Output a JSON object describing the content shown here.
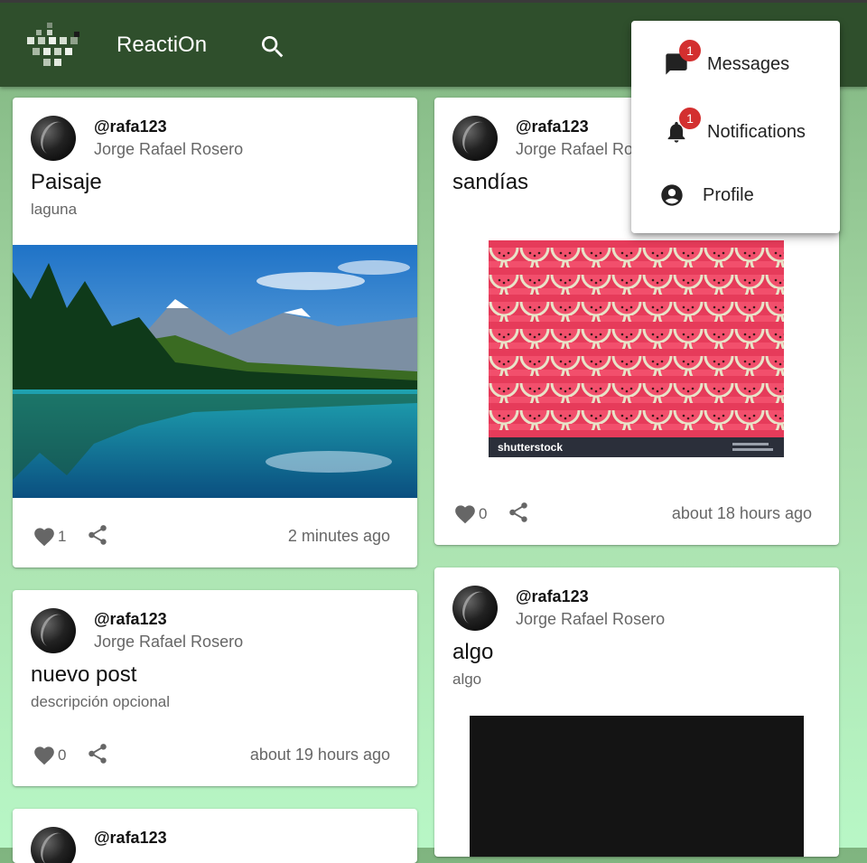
{
  "app": {
    "title": "ReactiOn"
  },
  "icons": {
    "logo": "pixel-logo-icon",
    "search": "search-icon",
    "like": "heart-icon",
    "share": "share-icon",
    "messages": "chat-icon",
    "notifications": "bell-icon",
    "profile": "account-circle-icon"
  },
  "colors": {
    "appbar": "#2f4f2c",
    "badge": "#d32f2f"
  },
  "menu": {
    "messages": {
      "label": "Messages",
      "badge": "1"
    },
    "notifications": {
      "label": "Notifications",
      "badge": "1"
    },
    "profile": {
      "label": "Profile"
    }
  },
  "posts": [
    {
      "username": "@rafa123",
      "fullname": "Jorge Rafael Rosero",
      "title": "Paisaje",
      "description": "laguna",
      "likes": "1",
      "time": "2 minutes ago"
    },
    {
      "username": "@rafa123",
      "fullname": "Jorge Rafael Rosero",
      "title": "sandías",
      "description": "",
      "likes": "0",
      "time": "about 18 hours ago",
      "image_watermark": "shutterstock"
    },
    {
      "username": "@rafa123",
      "fullname": "Jorge Rafael Rosero",
      "title": "nuevo post",
      "description": "descripción opcional",
      "likes": "0",
      "time": "about 19 hours ago"
    },
    {
      "username": "@rafa123",
      "fullname": "Jorge Rafael Rosero",
      "title": "algo",
      "description": "algo"
    },
    {
      "username": "@rafa123"
    }
  ]
}
